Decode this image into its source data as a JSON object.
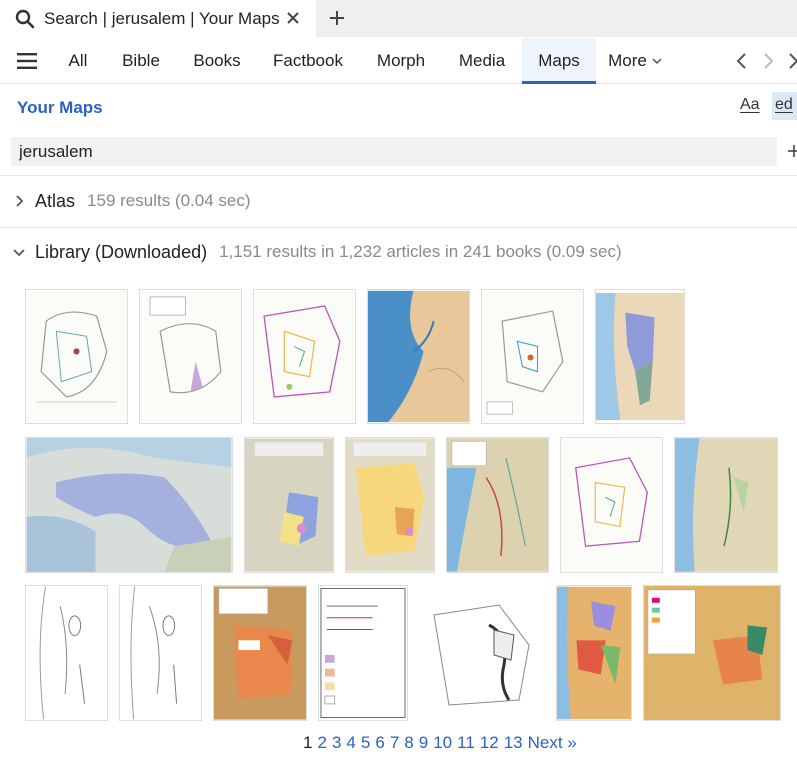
{
  "tab": {
    "title": "Search |  jerusalem | Your Maps"
  },
  "nav": {
    "tabs": [
      {
        "label": "All"
      },
      {
        "label": "Bible"
      },
      {
        "label": "Books"
      },
      {
        "label": "Factbook"
      },
      {
        "label": "Morph"
      },
      {
        "label": "Media"
      },
      {
        "label": "Maps"
      },
      {
        "label": "More"
      }
    ],
    "active_tab": "Maps"
  },
  "header": {
    "title": "Your Maps",
    "aa_label": "Aa",
    "ed_label": "ed"
  },
  "search": {
    "value": "jerusalem"
  },
  "atlas": {
    "name": "Atlas",
    "meta": "159 results (0.04 sec)",
    "expanded": false
  },
  "library": {
    "name": "Library (Downloaded)",
    "meta": "1,151 results in 1,232 articles in 241 books (0.09 sec)",
    "expanded": true
  },
  "pagination": {
    "current": "1",
    "pages": [
      "2",
      "3",
      "4",
      "5",
      "6",
      "7",
      "8",
      "9",
      "10",
      "11",
      "12",
      "13"
    ],
    "next_label": "Next »"
  },
  "colors": {
    "accent": "#2b62c4",
    "active_tab_bg": "#eef4fb"
  }
}
